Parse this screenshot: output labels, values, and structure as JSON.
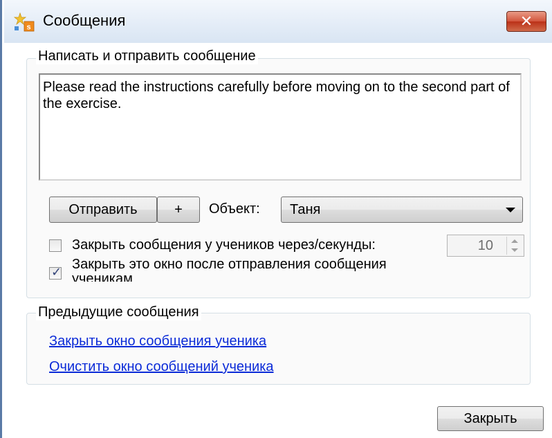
{
  "window": {
    "title": "Сообщения",
    "close_label": "✕"
  },
  "compose": {
    "group_title": "Написать и отправить сообщение",
    "message_text": "Please read the instructions carefully before moving on to the second part of the exercise.",
    "send_label": "Отправить",
    "plus_label": "+",
    "object_label": "Объект:",
    "recipient_selected": "Таня",
    "close_student_messages_label": "Закрыть сообщения у учеников через/секунды:",
    "close_student_messages_checked": false,
    "seconds_value": "10",
    "close_after_send_label_line1": "Закрыть это окно после отправления сообщения",
    "close_after_send_label_line2": "ученикам",
    "close_after_send_checked": true
  },
  "previous": {
    "group_title": "Предыдущие сообщения",
    "link_close": "Закрыть окно сообщения ученика",
    "link_clear": "Очистить окно сообщений ученика"
  },
  "footer": {
    "close_button_label": "Закрыть"
  },
  "colors": {
    "link": "#0b2bd8",
    "close_button": "#c9452b",
    "title_bar": "#dde8f5"
  }
}
